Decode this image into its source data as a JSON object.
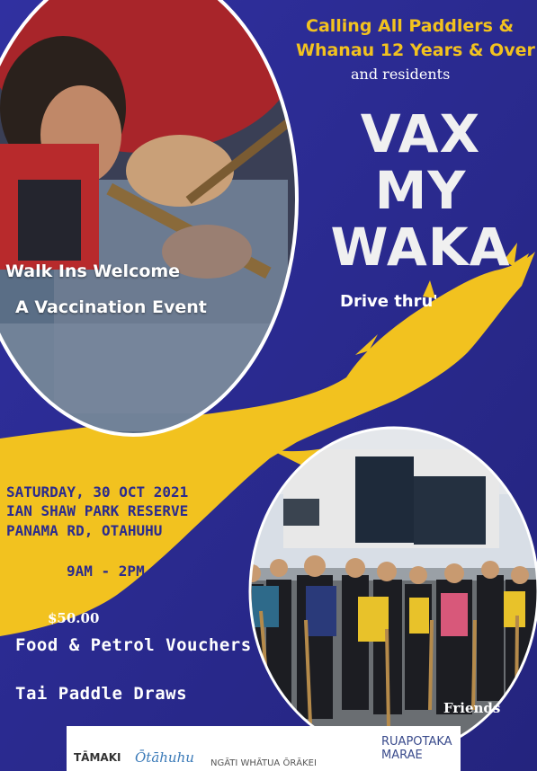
{
  "colors": {
    "background": "#2b2b8e",
    "accent_yellow": "#f2c21f",
    "title_text": "#f0f0f0"
  },
  "header": {
    "line1": "Calling All Paddlers &",
    "line2": "Whanau 12 Years & Over",
    "line3": "and residents"
  },
  "title": {
    "line1": "VAX",
    "line2": "MY",
    "line3": "WAKA"
  },
  "drive_thru": "Drive thru'",
  "left_circle": {
    "line1": "Walk Ins Welcome",
    "line2": "A Vaccination Event"
  },
  "details": {
    "date": "SATURDAY, 30 OCT 2021",
    "venue": "IAN SHAW PARK RESERVE",
    "road": "PANAMA RD, OTAHUHU",
    "time": "9AM - 2PM"
  },
  "incentives": {
    "amount": "$50.00",
    "vouchers": "Food & Petrol Vouchers",
    "draws": "Tai Paddle Draws"
  },
  "friends": "Friends",
  "sponsors": {
    "s1": "TĀMAKI",
    "s2": "Ōtāhuhu",
    "s3": "NGĀTI WHĀTUA ŌRĀKEI",
    "s4_line1": "RUAPOTAKA",
    "s4_line2": "MARAE"
  },
  "images": {
    "paddler_photo": "photo-paddler",
    "group_photo": "photo-paddling-team"
  }
}
